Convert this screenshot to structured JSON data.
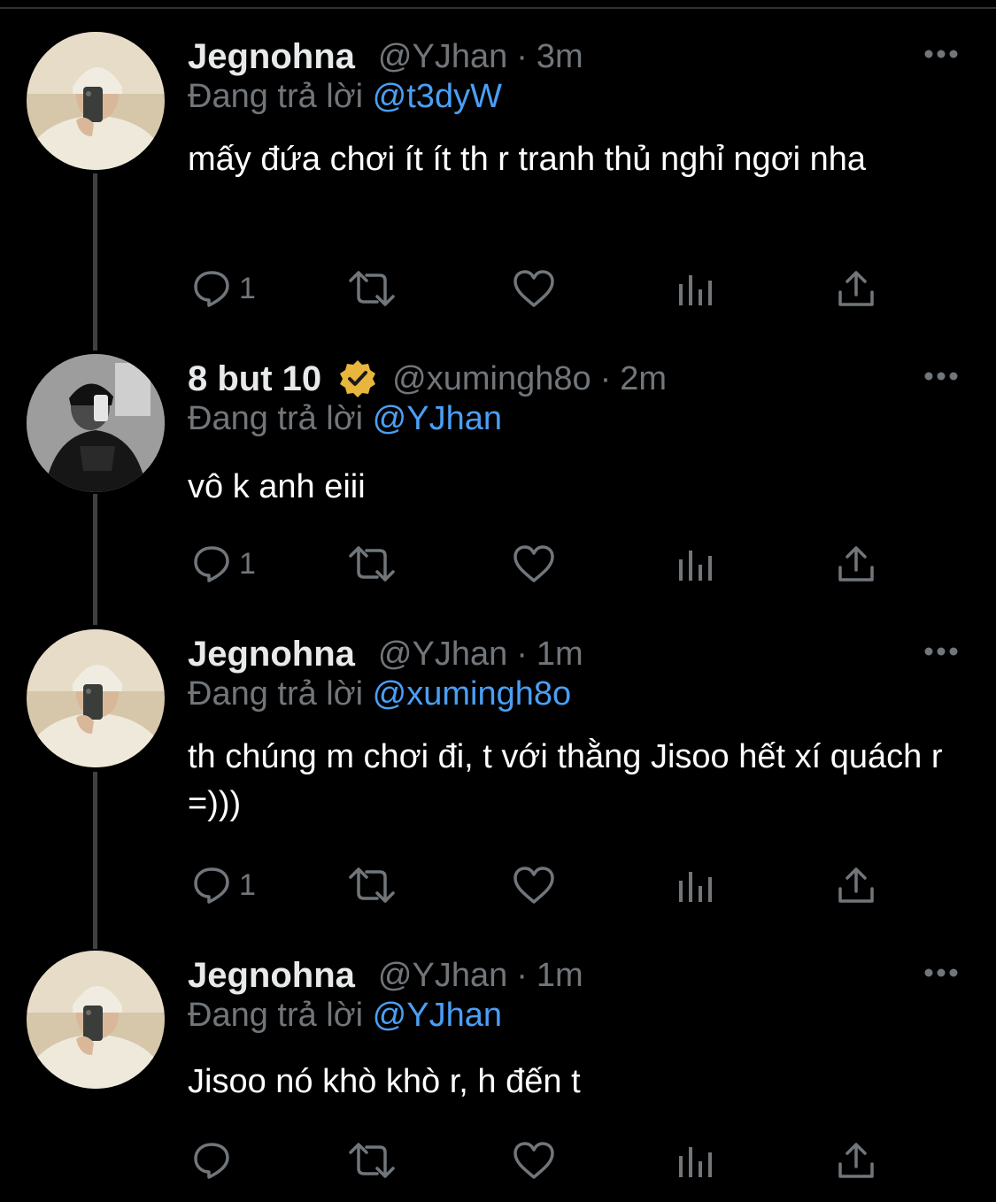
{
  "colors": {
    "background": "#000000",
    "primary_text": "#ffffff",
    "secondary_text": "#71767b",
    "mention": "#4a9ff5",
    "thread_line": "#3e4144",
    "verified_badge": "#e8b63c"
  },
  "reply_prefix": "Đang trả lời",
  "tweets": [
    {
      "name": "Jegnohna",
      "handle": "@YJhan",
      "dot": "·",
      "time": "3m",
      "reply_to": "@t3dyW",
      "text": "mấy đứa chơi ít ít th r tranh thủ nghỉ ngơi nha",
      "reply_count": "1",
      "verified": false,
      "avatar": "light-beanie-avatar"
    },
    {
      "name": "8 but 10",
      "handle": "@xumingh8o",
      "dot": "·",
      "time": "2m",
      "reply_to": "@YJhan",
      "text": "vô k anh eiii",
      "reply_count": "1",
      "verified": true,
      "avatar": "dark-mirror-selfie-avatar"
    },
    {
      "name": "Jegnohna",
      "handle": "@YJhan",
      "dot": "·",
      "time": "1m",
      "reply_to": "@xumingh8o",
      "text": "th chúng m chơi đi, t với thằng Jisoo hết xí quách r =)))",
      "reply_count": "1",
      "verified": false,
      "avatar": "light-beanie-avatar"
    },
    {
      "name": "Jegnohna",
      "handle": "@YJhan",
      "dot": "·",
      "time": "1m",
      "reply_to": "@YJhan",
      "text": "Jisoo nó khò khò r, h đến t",
      "reply_count": "",
      "verified": false,
      "avatar": "light-beanie-avatar"
    }
  ]
}
